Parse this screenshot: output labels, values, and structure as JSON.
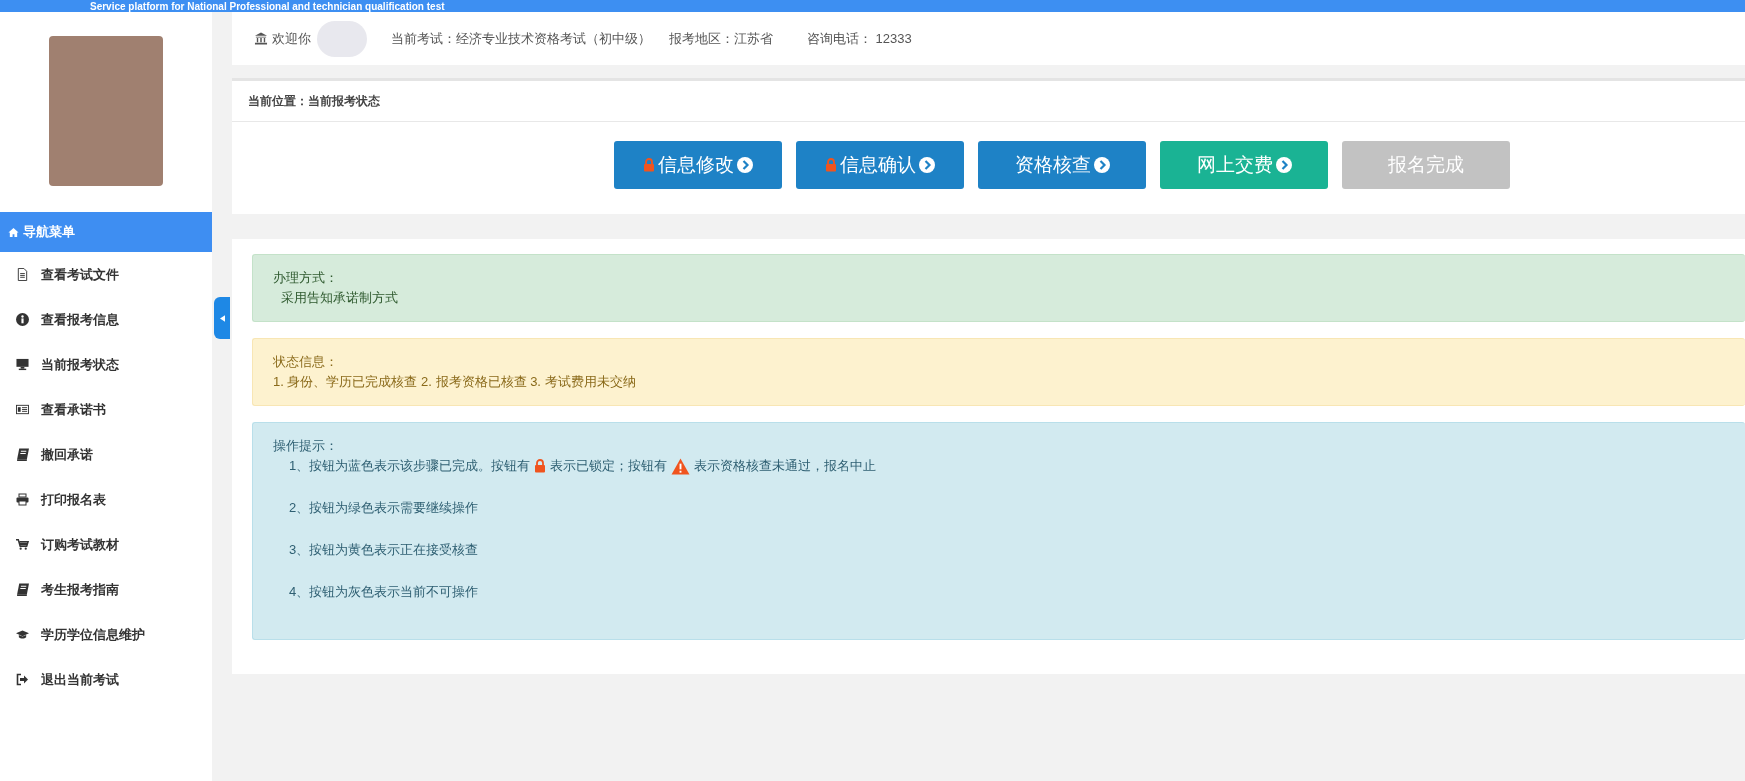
{
  "banner": {
    "title": "Service platform for National Professional and technician qualification test"
  },
  "header": {
    "welcome": "欢迎你",
    "exam": "当前考试：经济专业技术资格考试（初中级）",
    "region": "报考地区：江苏省",
    "phone": "咨询电话： 12333"
  },
  "sidebar": {
    "title": "导航菜单",
    "items": [
      {
        "label": "查看考试文件",
        "kind": "file"
      },
      {
        "label": "查看报考信息",
        "kind": "info"
      },
      {
        "label": "当前报考状态",
        "kind": "monitor"
      },
      {
        "label": "查看承诺书",
        "kind": "card"
      },
      {
        "label": "撤回承诺",
        "kind": "book"
      },
      {
        "label": "打印报名表",
        "kind": "print"
      },
      {
        "label": "订购考试教材",
        "kind": "cart"
      },
      {
        "label": "考生报考指南",
        "kind": "book"
      },
      {
        "label": "学历学位信息维护",
        "kind": "cap"
      },
      {
        "label": "退出当前考试",
        "kind": "exit"
      }
    ]
  },
  "breadcrumb": "当前位置：当前报考状态",
  "steps": [
    {
      "label": "信息修改",
      "kind": "completed",
      "locked": true
    },
    {
      "label": "信息确认",
      "kind": "completed",
      "locked": true
    },
    {
      "label": "资格核查",
      "kind": "completed",
      "locked": false
    },
    {
      "label": "网上交费",
      "kind": "continue",
      "locked": false
    },
    {
      "label": "报名完成",
      "kind": "unavailable",
      "locked": false
    }
  ],
  "alerts": [
    {
      "kind": "success",
      "title": "办理方式：",
      "lines": [
        [
          {
            "kind": "text",
            "text": "采用告知承诺制方式"
          }
        ]
      ]
    },
    {
      "kind": "warning",
      "title": "状态信息：",
      "lines": [
        [
          {
            "kind": "text",
            "text": "1. 身份、学历已完成核查 2. 报考资格已核查 3. 考试费用未交纳"
          }
        ]
      ]
    },
    {
      "kind": "info",
      "title": "操作提示：",
      "lines": [
        [
          {
            "kind": "text",
            "text": "1、按钮为蓝色表示该步骤已完成。按钮有"
          },
          {
            "kind": "lock"
          },
          {
            "kind": "text",
            "text": "表示已锁定；按钮有"
          },
          {
            "kind": "warning"
          },
          {
            "kind": "text",
            "text": "表示资格核查未通过，报名中止"
          }
        ],
        [
          {
            "kind": "text",
            "text": "2、按钮为绿色表示需要继续操作"
          }
        ],
        [
          {
            "kind": "text",
            "text": "3、按钮为黄色表示正在接受核查"
          }
        ],
        [
          {
            "kind": "text",
            "text": "4、按钮为灰色表示当前不可操作"
          }
        ]
      ]
    }
  ]
}
